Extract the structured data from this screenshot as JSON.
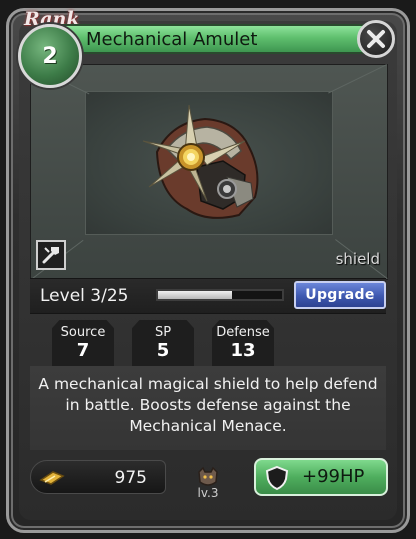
{
  "card": {
    "rank_label": "Rank",
    "rank_value": "2",
    "title": "Mechanical Amulet",
    "type_label": "shield",
    "item_icon": "mechanical-amulet-icon"
  },
  "level": {
    "text": "Level 3/25",
    "progress_fraction": 0.6,
    "upgrade_label": "Upgrade"
  },
  "stats": [
    {
      "label": "Source",
      "value": "7"
    },
    {
      "label": "SP",
      "value": "5"
    },
    {
      "label": "Defense",
      "value": "13"
    }
  ],
  "description": "A mechanical magical shield to help defend in battle. Boosts defense against the Mechanical Menace.",
  "footer": {
    "price": "975",
    "price_icon": "ticket-icon",
    "level_badge": "lv.3",
    "hp_button_label": "+99HP",
    "hp_icon": "shield-icon"
  },
  "colors": {
    "title_green": "#5fbf6e",
    "upgrade_blue": "#3e58b0",
    "hp_green": "#4fae5e"
  }
}
